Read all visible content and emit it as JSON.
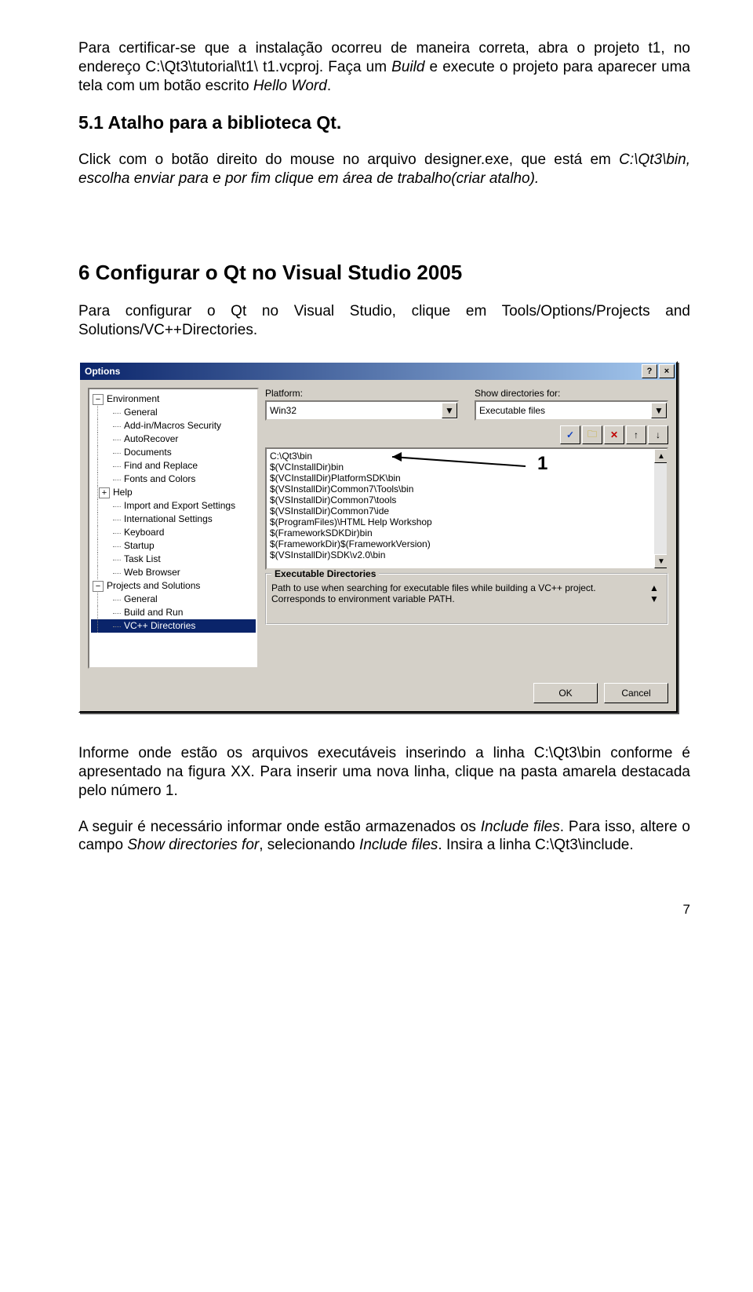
{
  "para1": {
    "a": "Para certificar-se que a instalação ocorreu de maneira correta, abra o projeto t1, no endereço C:\\Qt3\\tutorial\\t1\\ t1.vcproj. Faça um ",
    "b": "Build",
    "c": " e execute o projeto para aparecer uma tela com um botão escrito ",
    "d": "Hello Word",
    "e": "."
  },
  "h1": "5.1 Atalho para a biblioteca Qt.",
  "para2": {
    "a": "Click com o botão direito do mouse no arquivo designer.exe, que está em ",
    "b": "C:\\Qt3\\bin, escolha enviar para e por fim clique em área de trabalho(criar atalho).",
    "c": ""
  },
  "h2": "6 Configurar o Qt no Visual Studio 2005",
  "para3": "Para configurar o Qt no Visual Studio, clique em Tools/Options/Projects and Solutions/VC++Directories.",
  "dialog": {
    "title": "Options",
    "tree_root1": "Environment",
    "tree_children1": [
      "General",
      "Add-in/Macros Security",
      "AutoRecover",
      "Documents",
      "Find and Replace",
      "Fonts and Colors",
      "Help",
      "Import and Export Settings",
      "International Settings",
      "Keyboard",
      "Startup",
      "Task List",
      "Web Browser"
    ],
    "tree_root2": "Projects and Solutions",
    "tree_children2": [
      "General",
      "Build and Run",
      "VC++ Directories"
    ],
    "platform_label": "Platform:",
    "platform_value": "Win32",
    "show_label": "Show directories for:",
    "show_value": "Executable files",
    "list": [
      "C:\\Qt3\\bin",
      "$(VCInstallDir)bin",
      "$(VCInstallDir)PlatformSDK\\bin",
      "$(VSInstallDir)Common7\\Tools\\bin",
      "$(VSInstallDir)Common7\\tools",
      "$(VSInstallDir)Common7\\ide",
      "$(ProgramFiles)\\HTML Help Workshop",
      "$(FrameworkSDKDir)bin",
      "$(FrameworkDir)$(FrameworkVersion)",
      "$(VSInstallDir)SDK\\v2.0\\bin"
    ],
    "annot": "1",
    "desc_legend": "Executable Directories",
    "desc_text": "Path to use when searching for executable files while building a VC++ project.  Corresponds to environment variable PATH.",
    "ok": "OK",
    "cancel": "Cancel"
  },
  "para4": "Informe onde estão os arquivos executáveis inserindo a linha C:\\Qt3\\bin conforme é apresentado na figura XX. Para inserir uma nova linha, clique na pasta amarela destacada pelo número 1.",
  "para5": {
    "a": "A seguir é necessário informar onde estão armazenados os ",
    "b": "Include files",
    "c": ". Para isso, altere o campo ",
    "d": "Show directories for",
    "e": ", selecionando ",
    "f": "Include files",
    "g": ". Insira a linha C:\\Qt3\\include."
  },
  "pagenum": "7"
}
